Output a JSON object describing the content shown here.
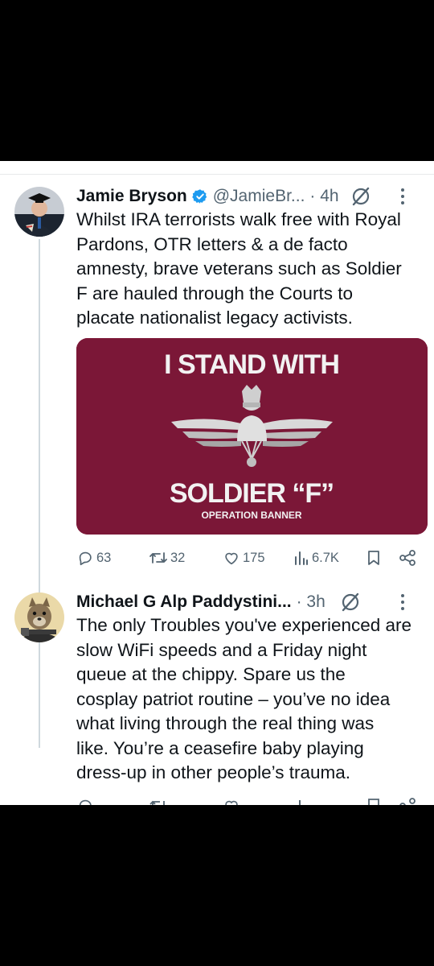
{
  "posts": [
    {
      "author_name": "Jamie Bryson",
      "handle": "@JamieBr...",
      "time": "· 4h",
      "text_lines": [
        "Whilst IRA terrorists walk free with Royal",
        "Pardons, OTR letters & a de facto",
        "amnesty, brave veterans such as Soldier",
        "F are hauled through the Courts to",
        "placate nationalist legacy activists."
      ],
      "image": {
        "title": "I STAND WITH",
        "subject": "SOLDIER “F”",
        "caption": "OPERATION BANNER",
        "background": "#7b1737"
      },
      "replies": "63",
      "reposts": "32",
      "likes": "175",
      "views": "6.7K"
    },
    {
      "author_name": "Michael G Alp Paddystini...",
      "time": "· 3h",
      "text_lines": [
        "The only Troubles you've experienced are",
        "slow WiFi speeds and a Friday night",
        "queue at the chippy. Spare us the",
        "cosplay patriot routine – you’ve no idea",
        "what living through the real thing was",
        "like.  You’re a ceasefire baby playing",
        "dress-up in other people’s trauma."
      ]
    }
  ],
  "colors": {
    "accent_blue": "#1d9bf0",
    "secondary_text": "#536471",
    "banner_maroon": "#7b1737"
  },
  "icons": [
    "verified-badge-icon",
    "grok-icon",
    "more-icon",
    "reply-icon",
    "repost-icon",
    "like-icon",
    "views-icon",
    "bookmark-icon",
    "share-icon"
  ]
}
